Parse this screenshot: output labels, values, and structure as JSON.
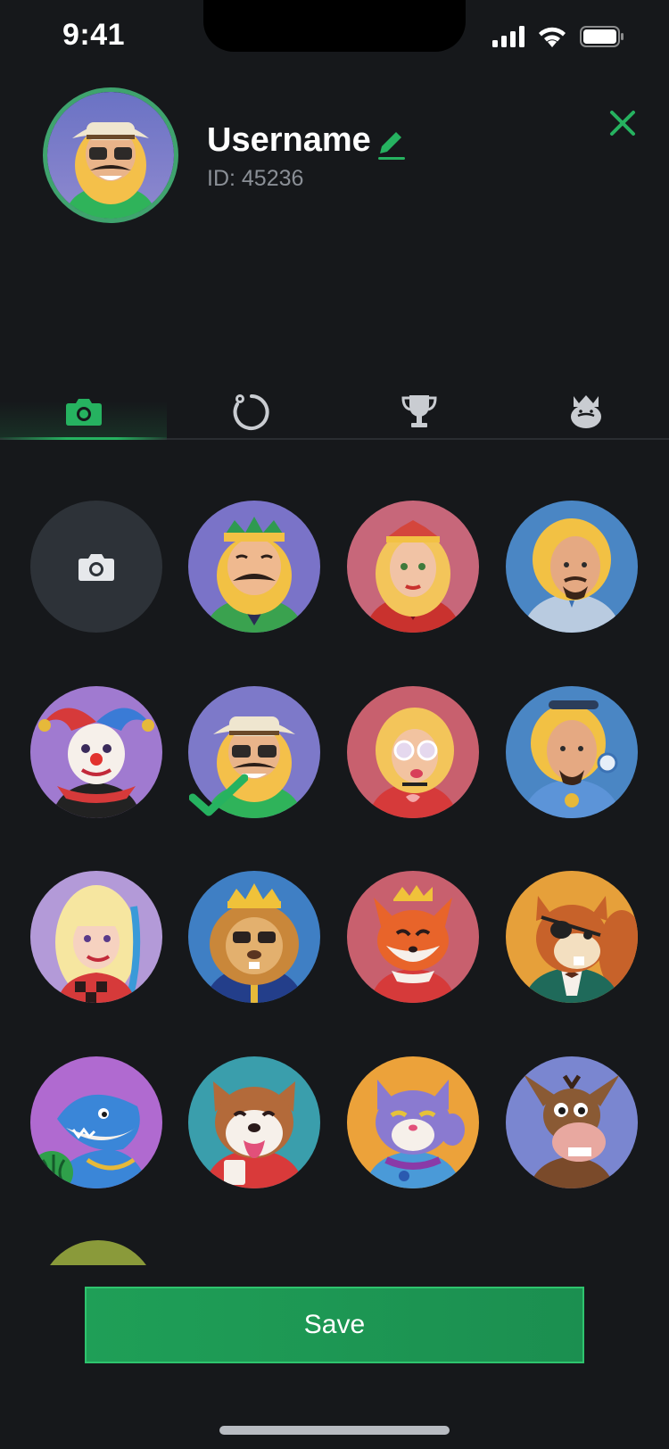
{
  "status_bar": {
    "time": "9:41"
  },
  "profile": {
    "username": "Username",
    "id_text": "ID: 45236",
    "avatar_icon": "safari-mustache-man-avatar"
  },
  "tabs": [
    {
      "icon": "camera-icon",
      "active": true
    },
    {
      "icon": "settings-ring-icon",
      "active": false
    },
    {
      "icon": "trophy-icon",
      "active": false
    },
    {
      "icon": "king-crown-icon",
      "active": false
    }
  ],
  "avatars": [
    {
      "name": "upload-photo",
      "kind": "upload"
    },
    {
      "name": "king-green",
      "selected": false
    },
    {
      "name": "queen-red",
      "selected": false
    },
    {
      "name": "blond-man-blue",
      "selected": false
    },
    {
      "name": "jester",
      "selected": false
    },
    {
      "name": "safari-man",
      "selected": true
    },
    {
      "name": "blonde-sunglasses-woman",
      "selected": false
    },
    {
      "name": "blond-man-chip",
      "selected": false
    },
    {
      "name": "blonde-woman-checkered",
      "selected": false
    },
    {
      "name": "lion-king",
      "selected": false
    },
    {
      "name": "fox-queen",
      "selected": false
    },
    {
      "name": "squirrel-pirate",
      "selected": false
    },
    {
      "name": "shark",
      "selected": false
    },
    {
      "name": "dog",
      "selected": false
    },
    {
      "name": "cat",
      "selected": false
    },
    {
      "name": "donkey",
      "selected": false
    }
  ],
  "colors": {
    "accent": "#26b260",
    "background": "#16181b"
  },
  "save_button": {
    "label": "Save"
  }
}
